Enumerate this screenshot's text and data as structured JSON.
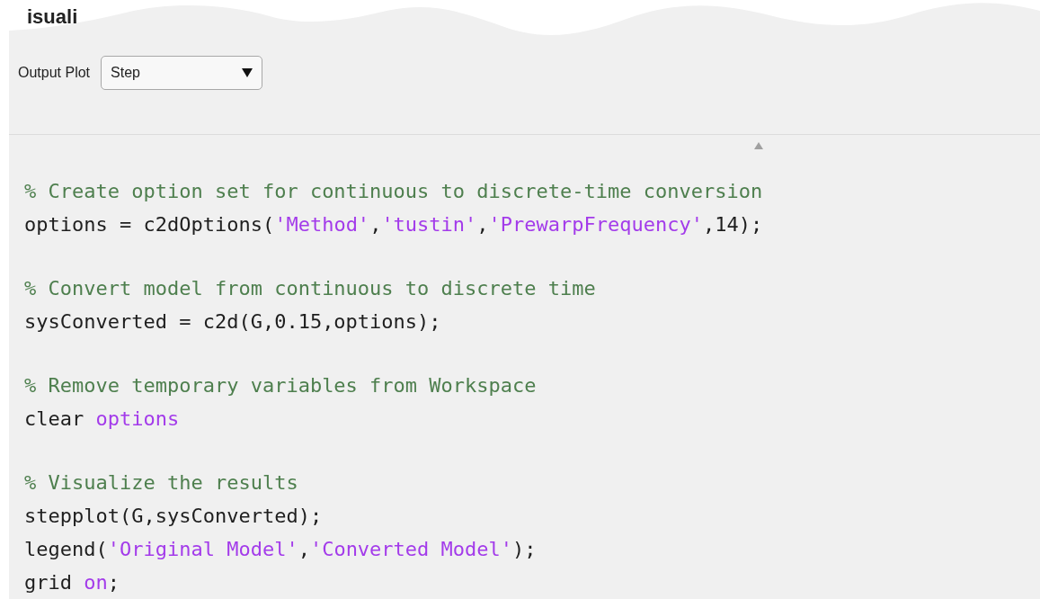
{
  "section": {
    "heading": "isuali",
    "control": {
      "label": "Output Plot",
      "value": "Step"
    }
  },
  "code_blocks": [
    {
      "lines": [
        [
          {
            "kind": "comment",
            "text": "% Create option set for continuous to discrete-time conversion"
          }
        ],
        [
          {
            "kind": "code",
            "text": "options = c2dOptions("
          },
          {
            "kind": "string",
            "text": "'Method'"
          },
          {
            "kind": "code",
            "text": ","
          },
          {
            "kind": "string",
            "text": "'tustin'"
          },
          {
            "kind": "code",
            "text": ","
          },
          {
            "kind": "string",
            "text": "'PrewarpFrequency'"
          },
          {
            "kind": "code",
            "text": ",14);"
          }
        ]
      ]
    },
    {
      "lines": [
        [
          {
            "kind": "comment",
            "text": "% Convert model from continuous to discrete time"
          }
        ],
        [
          {
            "kind": "code",
            "text": "sysConverted = c2d(G,0.15,options);"
          }
        ]
      ]
    },
    {
      "lines": [
        [
          {
            "kind": "comment",
            "text": "% Remove temporary variables from Workspace"
          }
        ],
        [
          {
            "kind": "code",
            "text": "clear "
          },
          {
            "kind": "string",
            "text": "options"
          }
        ]
      ]
    },
    {
      "lines": [
        [
          {
            "kind": "comment",
            "text": "% Visualize the results"
          }
        ],
        [
          {
            "kind": "code",
            "text": "stepplot(G,sysConverted);"
          }
        ],
        [
          {
            "kind": "code",
            "text": "legend("
          },
          {
            "kind": "string",
            "text": "'Original Model'"
          },
          {
            "kind": "code",
            "text": ","
          },
          {
            "kind": "string",
            "text": "'Converted Model'"
          },
          {
            "kind": "code",
            "text": ");"
          }
        ],
        [
          {
            "kind": "code",
            "text": "grid "
          },
          {
            "kind": "string",
            "text": "on"
          },
          {
            "kind": "code",
            "text": ";"
          }
        ]
      ]
    }
  ]
}
